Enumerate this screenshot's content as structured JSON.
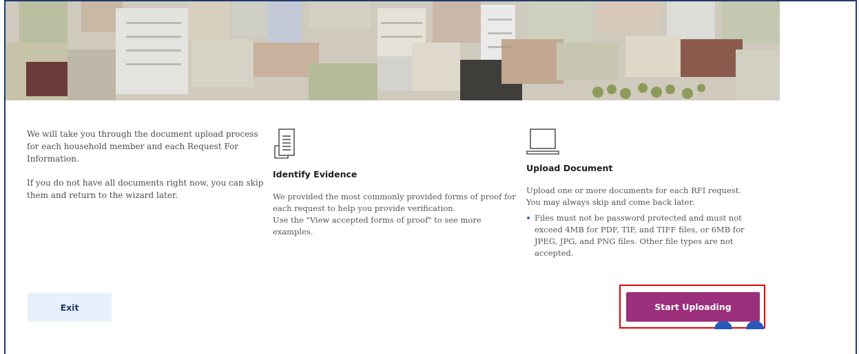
{
  "intro": {
    "line1": "We will take you through the document upload process for each household member and each Request For Information.",
    "line2": "If you do not have all documents right now, you can skip them and return to the wizard later."
  },
  "identify": {
    "icon": "document-icon",
    "title": "Identify Evidence",
    "text1": "We provided the most commonly provided forms of proof for each request to help you provide verification.",
    "text2": "Use the \"View accepted forms of proof\" to see more examples."
  },
  "upload": {
    "icon": "laptop-icon",
    "title": "Upload Document",
    "text": "Upload one or more documents for each RFI request. You may always skip and come back later.",
    "bullet": "Files must not be password protected and must not exceed 4MB for PDF, TIF, and TIFF files, or 6MB for JPEG, JPG, and PNG files. Other file types are not accepted."
  },
  "actions": {
    "exit_label": "Exit",
    "start_label": "Start Uploading"
  },
  "colors": {
    "primary": "#9b2f7c",
    "secondary_bg": "#e7f1fb",
    "highlight": "#e00000",
    "frame": "#1f3a6b"
  }
}
